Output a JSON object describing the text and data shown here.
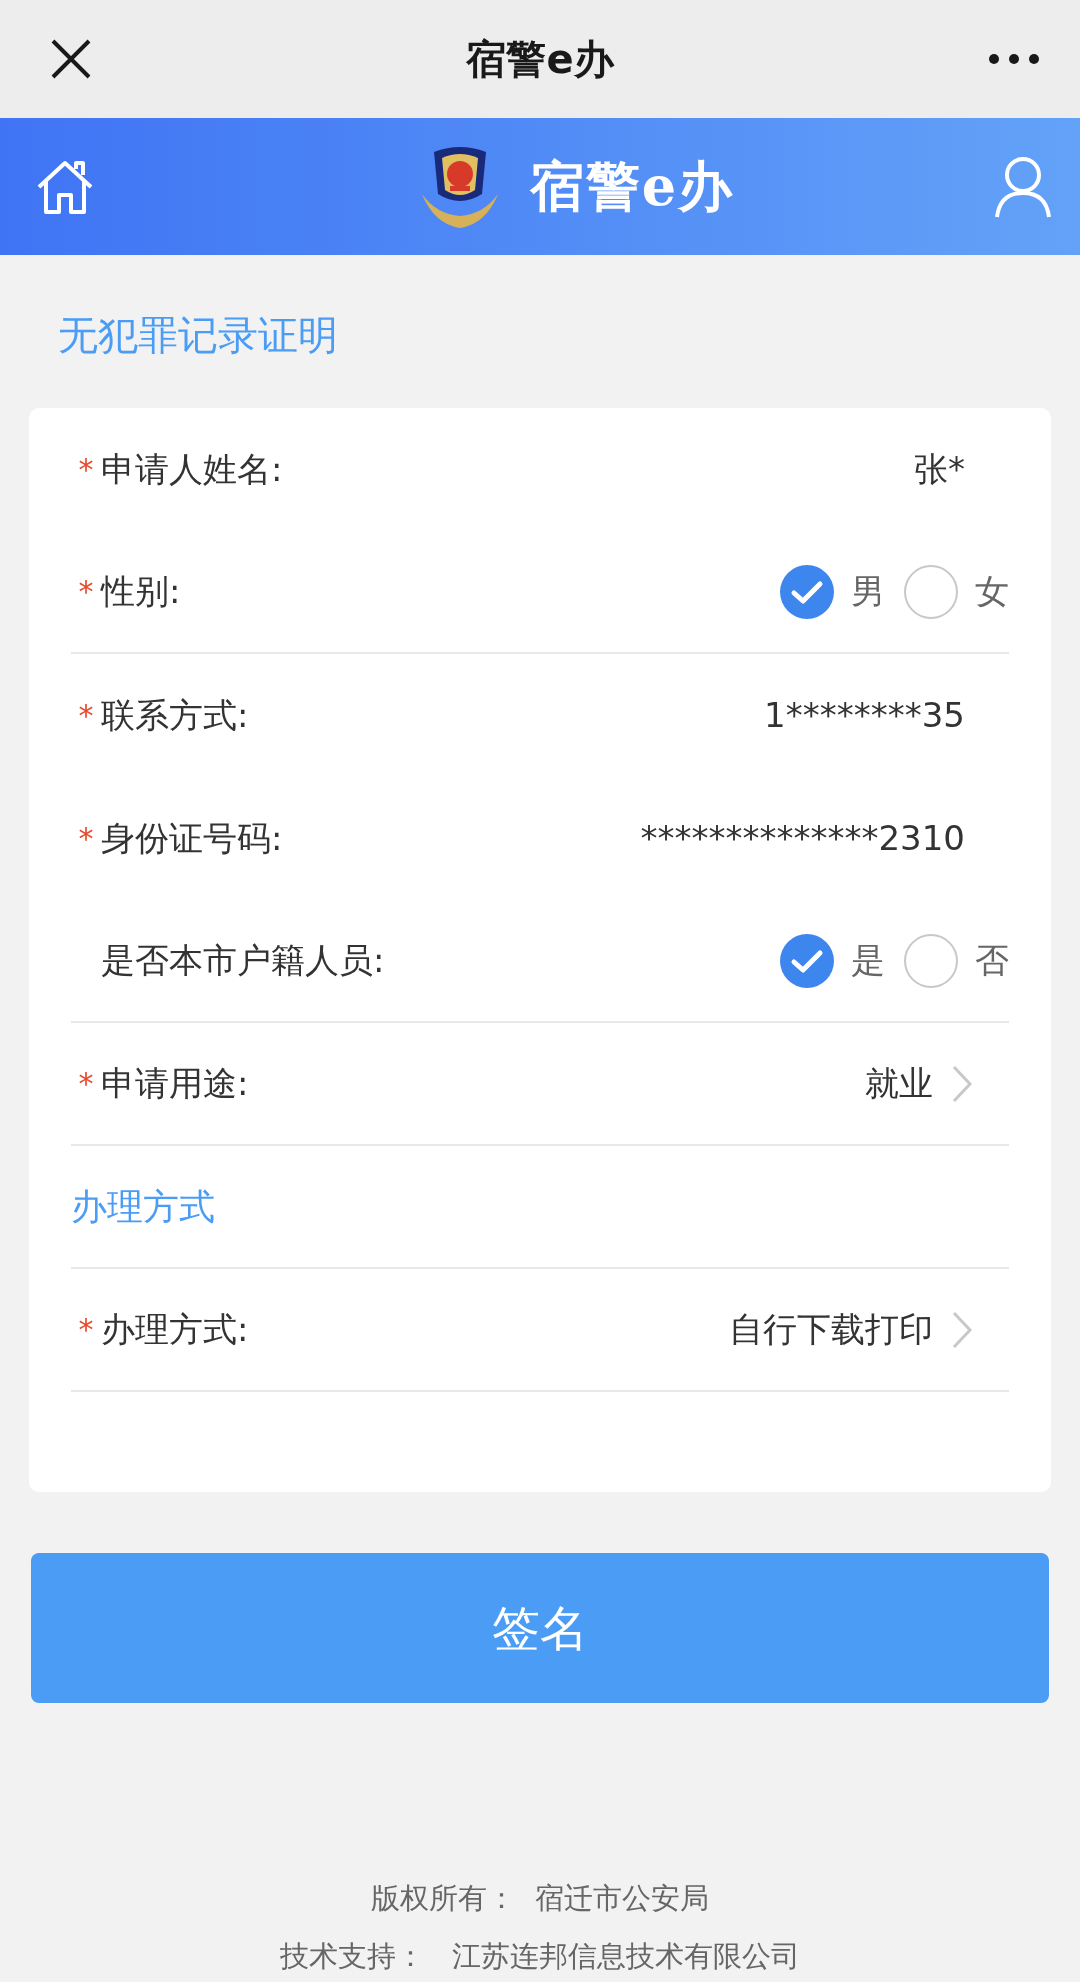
{
  "window": {
    "title": "宿警e办"
  },
  "banner": {
    "title": "宿警e办"
  },
  "page_title": "无犯罪记录证明",
  "row_groups": [
    [
      {
        "kind": "text",
        "required_mark": "*",
        "label": "申请人姓名:",
        "value": "张*"
      },
      {
        "kind": "radio",
        "required_mark": "*",
        "label": "性别:",
        "options": [
          {
            "label": "男",
            "selected": true
          },
          {
            "label": "女",
            "selected": false
          }
        ]
      }
    ],
    [
      {
        "kind": "text",
        "required_mark": "*",
        "label": "联系方式:",
        "value": "1********35"
      },
      {
        "kind": "text",
        "required_mark": "*",
        "label": "身份证号码:",
        "value": "**************2310"
      },
      {
        "kind": "radio",
        "label": "是否本市户籍人员:",
        "options": [
          {
            "label": "是",
            "selected": true
          },
          {
            "label": "否",
            "selected": false
          }
        ]
      }
    ],
    [
      {
        "kind": "select",
        "required_mark": "*",
        "label": "申请用途:",
        "value": "就业"
      }
    ],
    [
      {
        "kind": "section",
        "label": "办理方式"
      }
    ],
    [
      {
        "kind": "select",
        "required_mark": "*",
        "label": "办理方式:",
        "value": "自行下载打印"
      }
    ]
  ],
  "submit_button": "签名",
  "footer": [
    "版权所有：  宿迁市公安局",
    "技术支持：   江苏连邦信息技术有限公司"
  ]
}
